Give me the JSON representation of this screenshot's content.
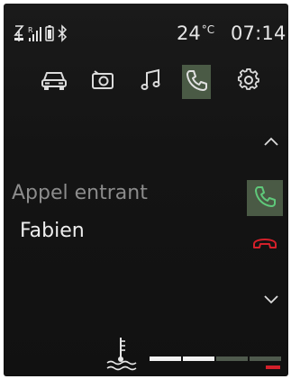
{
  "status_bar": {
    "icons": [
      "cellular-antenna-icon",
      "signal-strength-icon",
      "phone-battery-icon",
      "bluetooth-icon"
    ],
    "temperature": "24",
    "temperature_unit": "°C",
    "time": "07:14"
  },
  "app_bar": {
    "tabs": [
      {
        "icon": "car-icon",
        "active": false
      },
      {
        "icon": "media-source-icon",
        "active": false
      },
      {
        "icon": "music-note-icon",
        "active": false
      },
      {
        "icon": "phone-icon",
        "active": true
      },
      {
        "icon": "settings-gear-icon",
        "active": false
      }
    ]
  },
  "call": {
    "status_label": "Appel entrant",
    "caller_name": "Fabien"
  },
  "controls": {
    "scroll_up_icon": "chevron-up-icon",
    "answer_icon": "phone-answer-icon",
    "reject_icon": "phone-hangup-icon",
    "scroll_down_icon": "chevron-down-icon"
  },
  "coolant_gauge": {
    "icon": "coolant-temperature-icon",
    "segments_total": 4,
    "segments_lit": 2,
    "warning_color": "#d4202a"
  },
  "colors": {
    "accent_active": "#4a5a45",
    "answer_green": "#5fc97a",
    "reject_red": "#d4202a"
  }
}
